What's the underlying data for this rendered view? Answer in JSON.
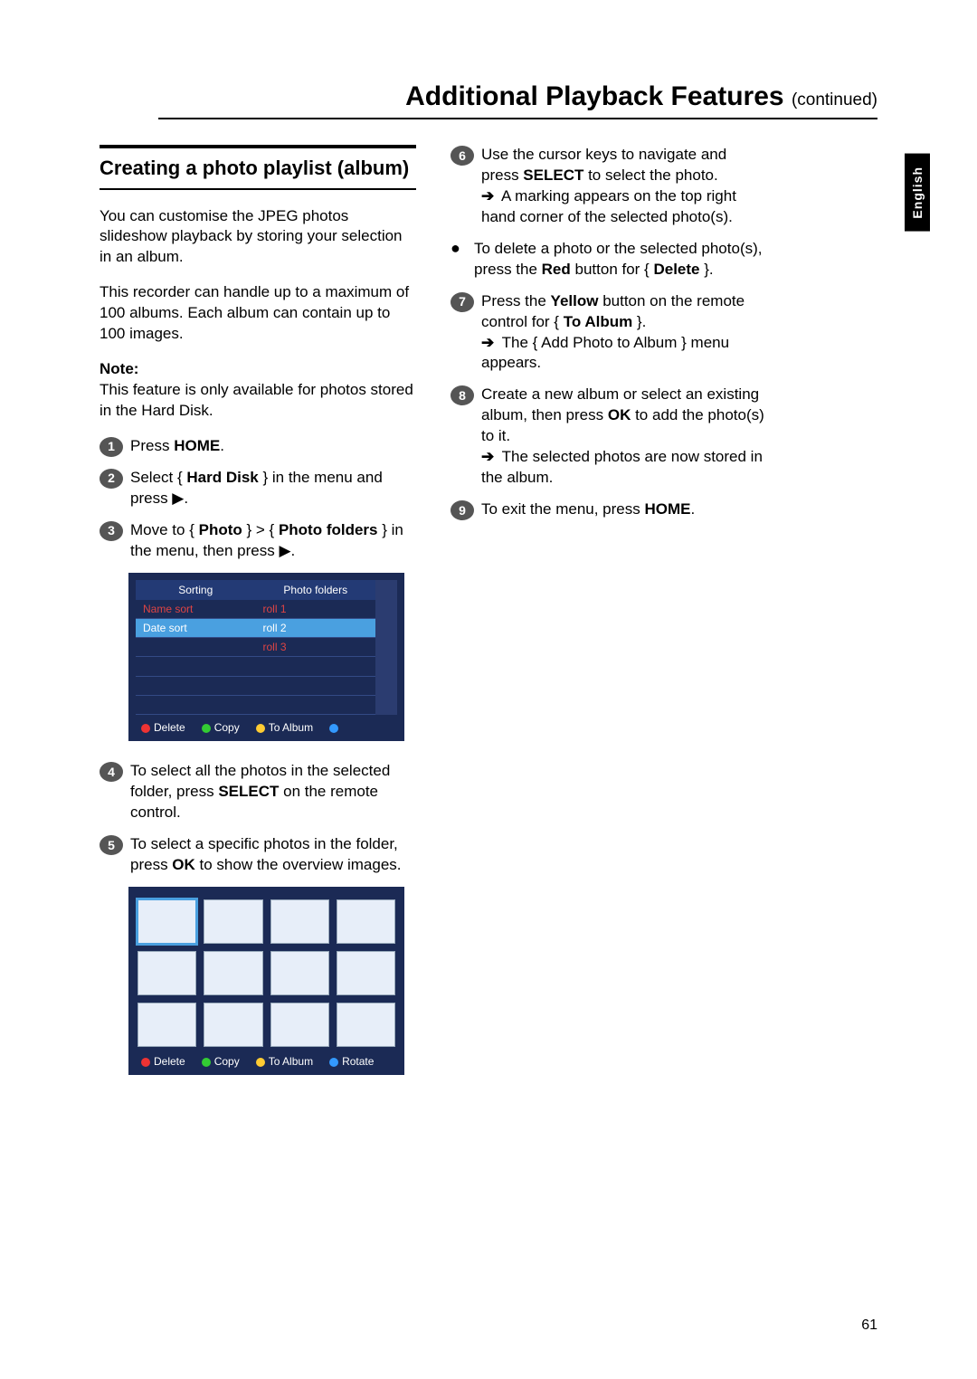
{
  "page_title_main": "Additional Playback Features ",
  "page_title_sub": "(continued)",
  "lang_tab": "English",
  "page_number": "61",
  "left": {
    "heading": "Creating a photo playlist (album)",
    "para1": "You can customise the JPEG photos slideshow playback by storing your selection in an album.",
    "para2": "This recorder can handle up to a maximum of 100 albums.  Each album can contain up to 100 images.",
    "note_label": "Note:",
    "note_text": "This feature is only available for photos stored in the Hard Disk.",
    "steps": {
      "s1": {
        "pre": "Press ",
        "b": "HOME",
        "post": "."
      },
      "s2": {
        "pre": "Select { ",
        "b": "Hard Disk",
        "mid": " } in the menu and press ",
        "g": "▶",
        "post": "."
      },
      "s3": {
        "pre": "Move to { ",
        "b1": "Photo",
        "mid1": " } > { ",
        "b2": "Photo folders",
        "mid2": " } in the menu, then press ",
        "g": "▶",
        "post": "."
      },
      "s4": {
        "pre": "To select all the photos in the selected folder, press ",
        "b": "SELECT",
        "post": " on the remote control."
      },
      "s5": {
        "pre": "To select a specific photos in the folder, press ",
        "b": "OK",
        "post": " to show the overview images."
      }
    },
    "panel1": {
      "colA_hdr": "Sorting",
      "colA_r1": "Name sort",
      "colA_r2": "Date sort",
      "colB_hdr": "Photo folders",
      "colB_r1": "roll 1",
      "colB_r2": "roll 2",
      "colB_r3": "roll 3",
      "footer": {
        "a": "Delete",
        "b": "Copy",
        "c": "To Album"
      }
    },
    "panel2": {
      "footer": {
        "a": "Delete",
        "b": "Copy",
        "c": "To Album",
        "d": "Rotate"
      }
    }
  },
  "right": {
    "s6": {
      "pre": "Use the cursor keys to navigate and press ",
      "b": "SELECT",
      "post": " to select the photo.",
      "sub": " A marking appears on the top right hand corner of the selected photo(s)."
    },
    "bullet": {
      "pre": "To delete a photo or the selected photo(s), press the ",
      "b1": "Red",
      "mid": " button for { ",
      "b2": "Delete",
      "post": " }."
    },
    "s7": {
      "pre": "Press the ",
      "b1": "Yellow",
      "mid1": " button on the remote control for { ",
      "b2": "To Album",
      "post": " }.",
      "sub": " The { Add Photo to Album } menu appears."
    },
    "s8": {
      "pre": "Create a new album or select an existing album, then press ",
      "b": "OK",
      "post": " to add the photo(s) to it.",
      "sub": " The selected photos are now stored in the album."
    },
    "s9": {
      "pre": "To exit the menu, press ",
      "b": "HOME",
      "post": "."
    }
  }
}
